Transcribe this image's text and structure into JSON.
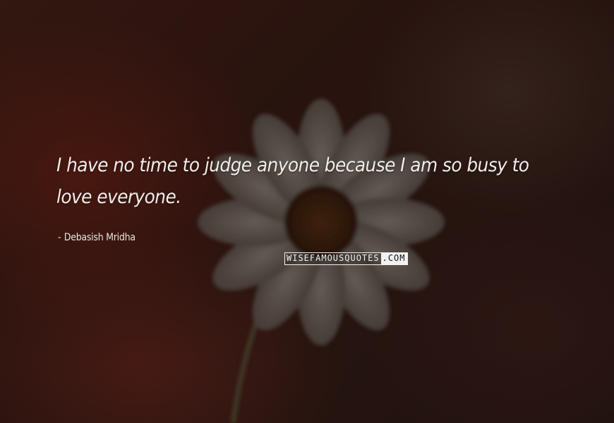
{
  "quote": {
    "text": "I have no time to judge anyone because I am so busy to love everyone."
  },
  "author": {
    "dash": "-",
    "name": "Debasish Mridha"
  },
  "watermark": {
    "part1": "WISEFAMOUSQUOTES",
    "part2": ".COM"
  },
  "colors": {
    "text": "#f1eeea",
    "background": "#2a1410"
  }
}
